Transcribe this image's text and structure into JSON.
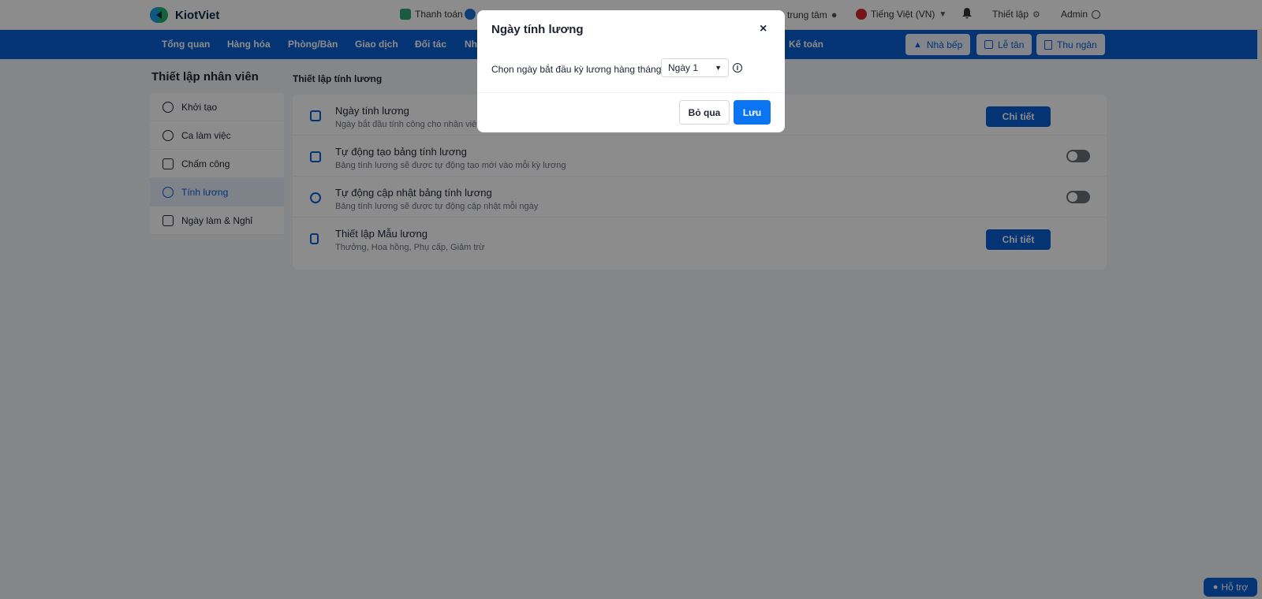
{
  "brand": {
    "name": "KiotViet"
  },
  "topbar": {
    "payment": "Thanh toán",
    "center": "trung tâm",
    "language": "Tiếng Việt (VN)",
    "settings": "Thiết lập",
    "user": "Admin"
  },
  "nav": {
    "items": [
      "Tổng quan",
      "Hàng hóa",
      "Phòng/Bàn",
      "Giao dịch",
      "Đối tác",
      "Nh",
      "Kế toán"
    ],
    "buttons": [
      "Nhà bếp",
      "Lễ tân",
      "Thu ngân"
    ]
  },
  "page": {
    "title": "Thiết lập nhân viên",
    "section_title": "Thiết lập tính lương"
  },
  "sidebar": {
    "items": [
      {
        "label": "Khởi tạo"
      },
      {
        "label": "Ca làm việc"
      },
      {
        "label": "Chấm công"
      },
      {
        "label": "Tính lương"
      },
      {
        "label": "Ngày làm & Nghỉ"
      }
    ]
  },
  "rows": [
    {
      "title": "Ngày tính lương",
      "desc": "Ngày bắt đầu tính công cho nhân viên",
      "action": "Chi tiết"
    },
    {
      "title": "Tự động tạo bảng tính lương",
      "desc": "Bảng tính lương sẽ được tự động tạo mới vào mỗi kỳ lương"
    },
    {
      "title": "Tự động cập nhật bảng tính lương",
      "desc": "Bảng tính lương sẽ được tự động cập nhật mỗi ngày"
    },
    {
      "title": "Thiết lập Mẫu lương",
      "desc": "Thưởng, Hoa hồng, Phụ cấp, Giảm trừ",
      "action": "Chi tiết"
    }
  ],
  "help": {
    "label": "Hỗ trợ"
  },
  "modal": {
    "title": "Ngày tính lương",
    "close": "×",
    "label": "Chọn ngày bắt đầu kỳ lương hàng tháng",
    "select_value": "Ngày 1",
    "cancel": "Bỏ qua",
    "save": "Lưu"
  },
  "colors": {
    "primary": "#0a5fd4",
    "save_button": "#0a74f2"
  }
}
